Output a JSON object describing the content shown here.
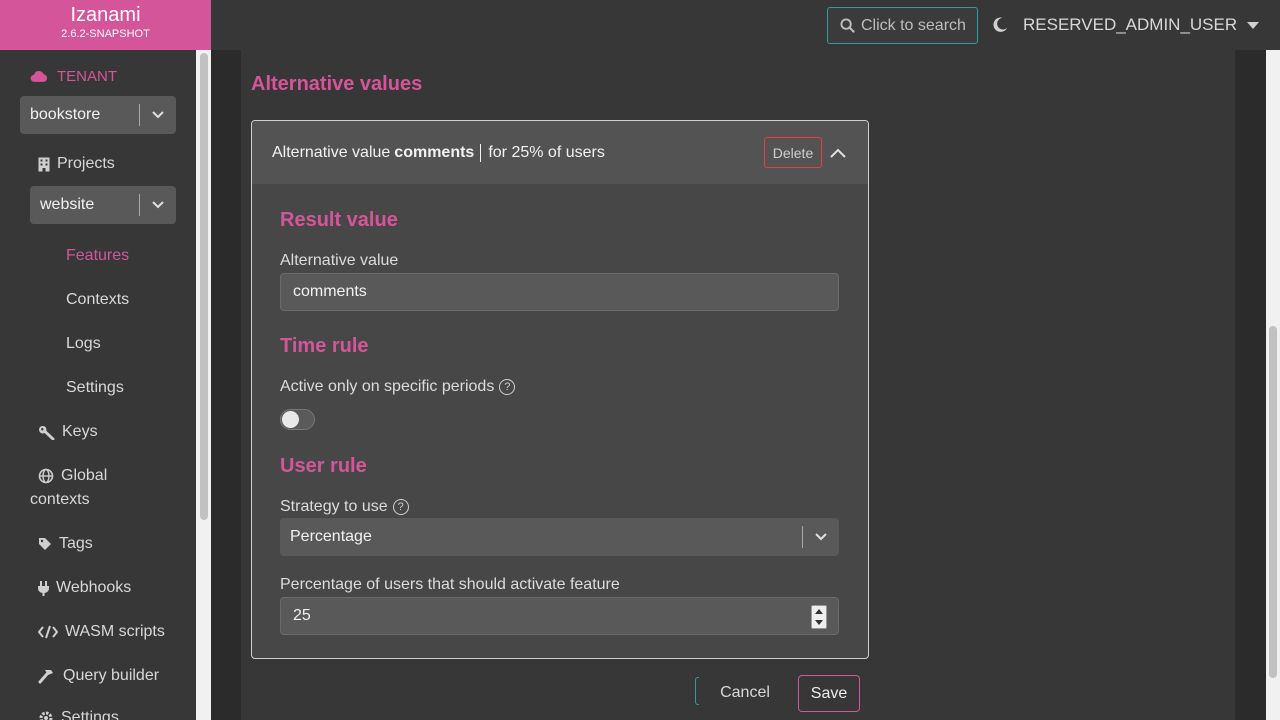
{
  "app": {
    "name": "Izanami",
    "version": "2.6.2-SNAPSHOT"
  },
  "topbar": {
    "search_label": "Click to search",
    "theme_icon": "moon-icon",
    "user": "RESERVED_ADMIN_USER"
  },
  "sidebar": {
    "tenant_label": "TENANT",
    "tenant_select": "bookstore",
    "projects_label": "Projects",
    "project_select": "website",
    "project_items": [
      {
        "label": "Features",
        "active": true
      },
      {
        "label": "Contexts"
      },
      {
        "label": "Logs"
      },
      {
        "label": "Settings"
      }
    ],
    "items": [
      {
        "label": "Keys",
        "icon": "key-icon"
      },
      {
        "label": "Global",
        "label2": "contexts",
        "icon": "globe-icon"
      },
      {
        "label": "Tags",
        "icon": "tag-icon"
      },
      {
        "label": "Webhooks",
        "icon": "plug-icon"
      },
      {
        "label": "WASM scripts",
        "icon": "code-icon"
      },
      {
        "label": "Query builder",
        "icon": "hammer-icon"
      },
      {
        "label": "Settings",
        "icon": "gear-icon"
      }
    ]
  },
  "main": {
    "section_title": "Alternative values",
    "card": {
      "head_prefix": "Alternative value",
      "head_value": "comments",
      "head_suffix": "for 25% of users",
      "delete_label": "Delete",
      "result_title": "Result value",
      "alt_value_label": "Alternative value",
      "alt_value": "comments",
      "time_title": "Time rule",
      "time_label": "Active only on specific periods",
      "time_toggle_on": false,
      "user_title": "User rule",
      "strategy_label": "Strategy to use",
      "strategy_value": "Percentage",
      "percentage_label": "Percentage of users that should activate feature",
      "percentage_value": "25"
    },
    "cancel_label": "Cancel",
    "save_label": "Save"
  },
  "colors": {
    "accent": "#d5559a",
    "teal": "#2f9da2",
    "danger": "#e0403e"
  }
}
